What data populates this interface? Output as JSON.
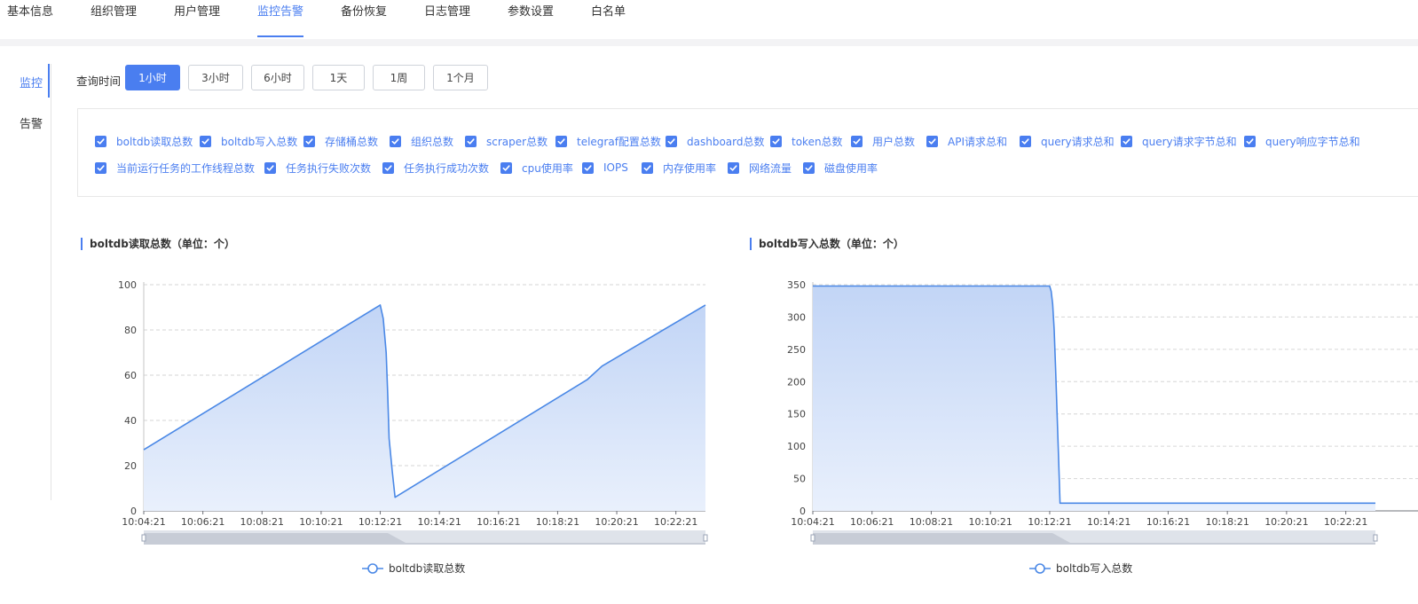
{
  "top_tabs": [
    {
      "label": "基本信息",
      "active": false
    },
    {
      "label": "组织管理",
      "active": false
    },
    {
      "label": "用户管理",
      "active": false
    },
    {
      "label": "监控告警",
      "active": true
    },
    {
      "label": "备份恢复",
      "active": false
    },
    {
      "label": "日志管理",
      "active": false
    },
    {
      "label": "参数设置",
      "active": false
    },
    {
      "label": "白名单",
      "active": false
    }
  ],
  "side_nav": [
    {
      "label": "监控",
      "active": true
    },
    {
      "label": "告警",
      "active": false
    }
  ],
  "query": {
    "label": "查询时间",
    "options": [
      {
        "label": "1小时",
        "active": true
      },
      {
        "label": "3小时",
        "active": false
      },
      {
        "label": "6小时",
        "active": false
      },
      {
        "label": "1天",
        "active": false
      },
      {
        "label": "1周",
        "active": false
      },
      {
        "label": "1个月",
        "active": false
      }
    ]
  },
  "metrics": [
    {
      "label": "boltdb读取总数",
      "checked": true
    },
    {
      "label": "boltdb写入总数",
      "checked": true
    },
    {
      "label": "存储桶总数",
      "checked": true
    },
    {
      "label": "组织总数",
      "checked": true
    },
    {
      "label": "scraper总数",
      "checked": true
    },
    {
      "label": "telegraf配置总数",
      "checked": true
    },
    {
      "label": "dashboard总数",
      "checked": true
    },
    {
      "label": "token总数",
      "checked": true
    },
    {
      "label": "用户总数",
      "checked": true
    },
    {
      "label": "API请求总和",
      "checked": true
    },
    {
      "label": "query请求总和",
      "checked": true
    },
    {
      "label": "query请求字节总和",
      "checked": true
    },
    {
      "label": "query响应字节总和",
      "checked": true
    },
    {
      "label": "当前运行任务的工作线程总数",
      "checked": true
    },
    {
      "label": "任务执行失败次数",
      "checked": true
    },
    {
      "label": "任务执行成功次数",
      "checked": true
    },
    {
      "label": "cpu使用率",
      "checked": true
    },
    {
      "label": "IOPS",
      "checked": true
    },
    {
      "label": "内存使用率",
      "checked": true
    },
    {
      "label": "网络流量",
      "checked": true
    },
    {
      "label": "磁盘使用率",
      "checked": true
    }
  ],
  "colors": {
    "accent": "#4a7ef0",
    "line": "#4a88e6",
    "area_top": "#c2d5f6",
    "area_bottom": "#e9f0fc"
  },
  "chart_data": [
    {
      "type": "area",
      "title": "boltdb读取总数（单位：个）",
      "legend": "boltdb读取总数",
      "x_ticks": [
        "10:04:21",
        "10:06:21",
        "10:08:21",
        "10:10:21",
        "10:12:21",
        "10:14:21",
        "10:16:21",
        "10:18:21",
        "10:20:21",
        "10:22:21"
      ],
      "y_ticks": [
        0,
        20,
        40,
        60,
        80,
        100
      ],
      "ylim": [
        0,
        100
      ],
      "xlim_minutes": [
        0,
        19
      ],
      "grid": true,
      "legend_position": "bottom",
      "series": [
        {
          "name": "boltdb读取总数",
          "x_minutes": [
            0,
            8.0,
            8.1,
            8.2,
            8.25,
            8.3,
            8.4,
            8.5,
            15.0,
            15.5,
            19.0
          ],
          "values": [
            27,
            91,
            85,
            70,
            52,
            32,
            18,
            6,
            58,
            64,
            91
          ]
        }
      ]
    },
    {
      "type": "area",
      "title": "boltdb写入总数（单位：个）",
      "legend": "boltdb写入总数",
      "x_ticks": [
        "10:04:21",
        "10:06:21",
        "10:08:21",
        "10:10:21",
        "10:12:21",
        "10:14:21",
        "10:16:21",
        "10:18:21",
        "10:20:21",
        "10:22:21"
      ],
      "y_ticks": [
        0,
        50,
        100,
        150,
        200,
        250,
        300,
        350
      ],
      "ylim": [
        0,
        350
      ],
      "xlim_minutes": [
        0,
        19
      ],
      "grid": true,
      "legend_position": "bottom",
      "series": [
        {
          "name": "boltdb写入总数",
          "x_minutes": [
            0,
            8.0,
            8.05,
            8.1,
            8.15,
            8.2,
            8.25,
            8.3,
            8.35,
            19.0
          ],
          "values": [
            348,
            348,
            340,
            320,
            280,
            220,
            150,
            80,
            12,
            12
          ]
        }
      ]
    }
  ]
}
